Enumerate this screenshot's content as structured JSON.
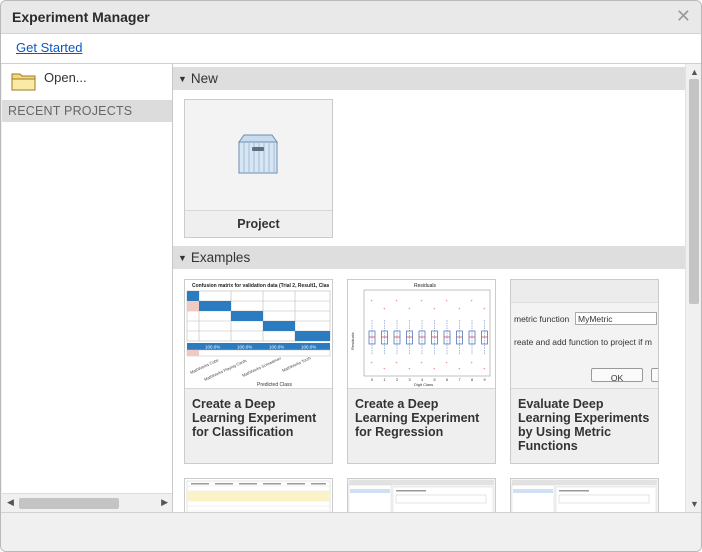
{
  "window": {
    "title": "Experiment Manager"
  },
  "links": {
    "get_started": "Get Started"
  },
  "left": {
    "open_label": "Open...",
    "recent_header": "RECENT PROJECTS"
  },
  "sections": {
    "new": "New",
    "examples": "Examples"
  },
  "new_cards": [
    {
      "label": "Project"
    }
  ],
  "example_cards": [
    {
      "lines": [
        "Create a Deep",
        "Learning Experiment",
        "for Classification"
      ]
    },
    {
      "lines": [
        "Create a Deep",
        "Learning Experiment",
        "for Regression"
      ]
    },
    {
      "lines": [
        "Evaluate Deep",
        "Learning Experiments",
        "by Using Metric",
        "Functions"
      ]
    }
  ],
  "thumb_text": {
    "confusion_title": "Confusion matrix for validation data (Trial 2, Result1, Clas",
    "confusion_xlabel": "Predicted Class",
    "confusion_pct": [
      "100.0%",
      "100.0%",
      "100.0%",
      "100.0%"
    ],
    "confusion_cats": [
      "MathWorks Cube",
      "MathWorks Playing Cards",
      "MathWorks Screwdriver",
      "MathWorks Torch"
    ],
    "regression_title": "Residuals",
    "regression_xlabel": "Digit Class",
    "regression_ylabel": "Residuals",
    "regression_ticks": [
      "0",
      "1",
      "2",
      "3",
      "4",
      "5",
      "6",
      "7",
      "8",
      "9"
    ],
    "metric_label": "metric function",
    "metric_value": "MyMetric",
    "metric_desc": "reate and add function to project if m",
    "ok_label": "OK"
  },
  "colors": {
    "accent_link": "#0b57c5",
    "matrix_blue": "#2a7bc0",
    "matrix_pink": "#f2c9c1"
  }
}
